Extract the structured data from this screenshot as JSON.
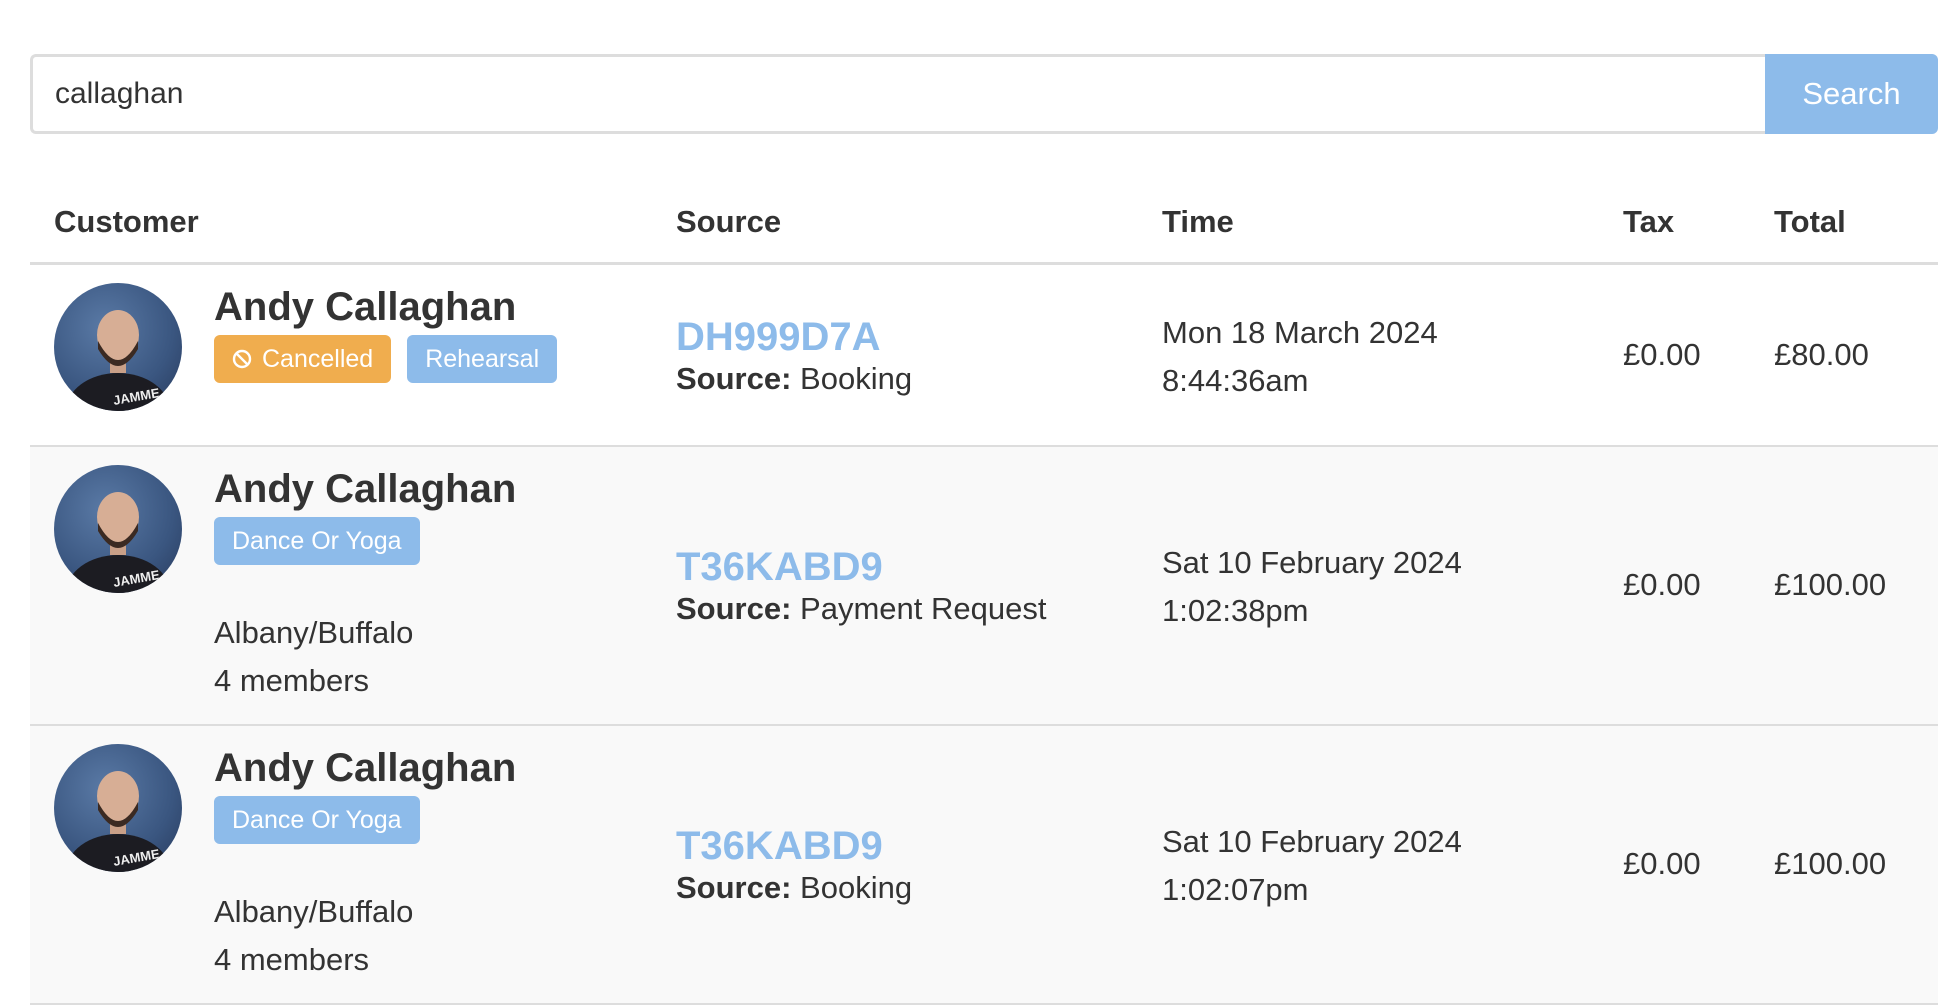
{
  "search": {
    "value": "callaghan",
    "button_label": "Search"
  },
  "table": {
    "headers": {
      "customer": "Customer",
      "source": "Source",
      "time": "Time",
      "tax": "Tax",
      "total": "Total"
    },
    "rows": [
      {
        "customer_name": "Andy Callaghan",
        "badges": [
          "Cancelled",
          "Rehearsal"
        ],
        "group": "",
        "members": "",
        "source_code": "DH999D7A",
        "source_prefix": "Source:",
        "source_type": "Booking",
        "date": "Mon 18 March 2024",
        "time": "8:44:36am",
        "tax": "£0.00",
        "total": "£80.00"
      },
      {
        "customer_name": "Andy Callaghan",
        "badges": [
          "Dance Or Yoga"
        ],
        "group": "Albany/Buffalo",
        "members": "4 members",
        "source_code": "T36KABD9",
        "source_prefix": "Source:",
        "source_type": "Payment Request",
        "date": "Sat 10 February 2024",
        "time": "1:02:38pm",
        "tax": "£0.00",
        "total": "£100.00"
      },
      {
        "customer_name": "Andy Callaghan",
        "badges": [
          "Dance Or Yoga"
        ],
        "group": "Albany/Buffalo",
        "members": "4 members",
        "source_code": "T36KABD9",
        "source_prefix": "Source:",
        "source_type": "Booking",
        "date": "Sat 10 February 2024",
        "time": "1:02:07pm",
        "tax": "£0.00",
        "total": "£100.00"
      }
    ]
  },
  "icons": {
    "cancelled_badge": "ban-icon",
    "avatar": "avatar-photo"
  },
  "colors": {
    "accent": "#8dbbea",
    "warning": "#f0ad4e",
    "text": "#333333",
    "border": "#dddddd",
    "row_stripe": "#f9f9f9"
  }
}
